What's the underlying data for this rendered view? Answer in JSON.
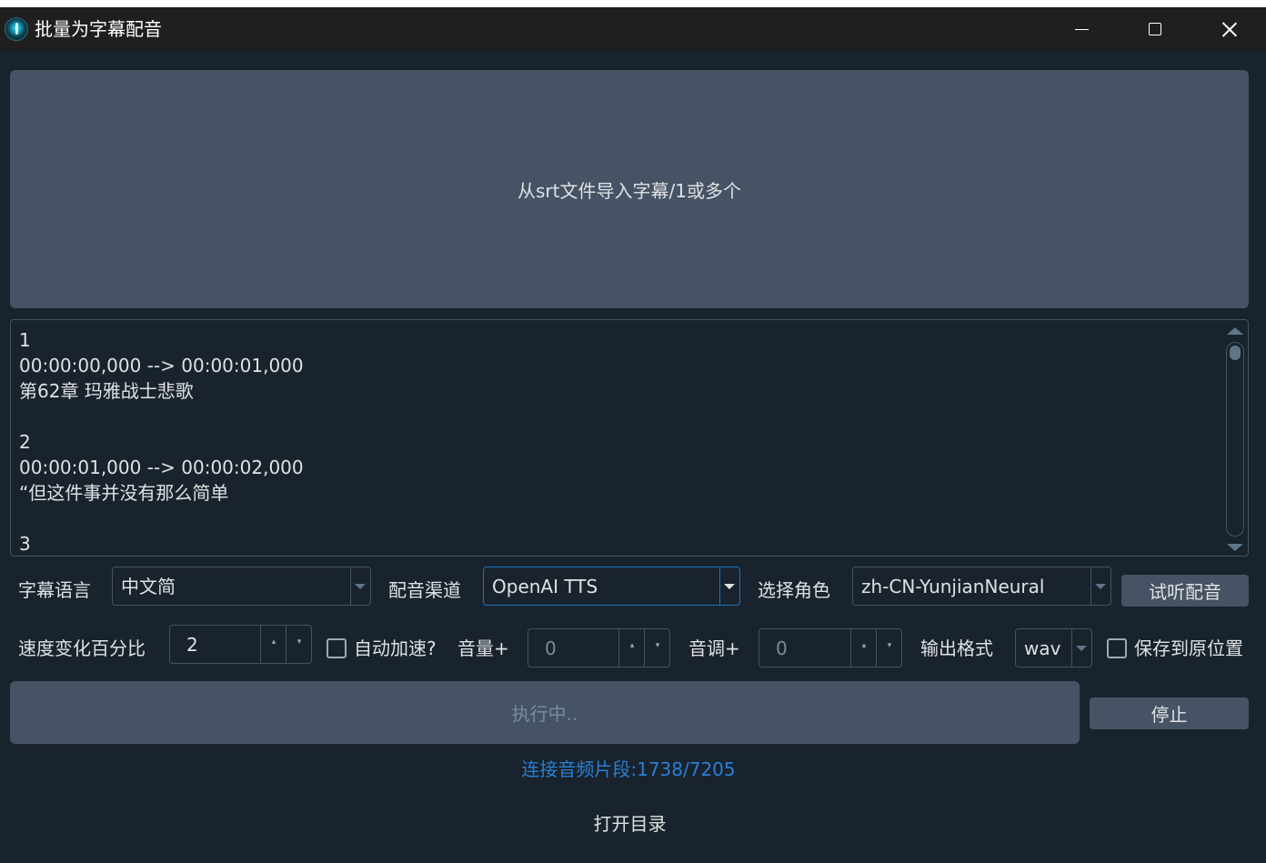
{
  "window": {
    "title": "批量为字幕配音"
  },
  "import_button_label": "从srt文件导入字幕/1或多个",
  "srt_content": {
    "lines": [
      "1",
      "00:00:00,000 --> 00:00:01,000",
      "第62章 玛雅战士悲歌",
      "",
      "2",
      "00:00:01,000 --> 00:00:02,000",
      "“但这件事并没有那么简单",
      "",
      "3"
    ]
  },
  "row1": {
    "subtitle_lang_label": "字幕语言",
    "subtitle_lang_value": "中文简",
    "tts_channel_label": "配音渠道",
    "tts_channel_value": "OpenAI TTS",
    "role_label": "选择角色",
    "role_value": "zh-CN-YunjianNeural",
    "preview_button": "试听配音"
  },
  "row2": {
    "speed_label": "速度变化百分比",
    "speed_value": "2",
    "auto_speed_label": "自动加速?",
    "auto_speed_checked": false,
    "volume_label": "音量+",
    "volume_value": "0",
    "pitch_label": "音调+",
    "pitch_value": "0",
    "format_label": "输出格式",
    "format_value": "wav",
    "save_original_label": "保存到原位置",
    "save_original_checked": false
  },
  "run": {
    "execute_label": "执行中..",
    "stop_label": "停止"
  },
  "status": {
    "text": "连接音频片段:1738/7205",
    "color": "#2a7fd4"
  },
  "open_dir_label": "打开目录",
  "colors": {
    "background": "#19232d",
    "button": "#455364",
    "accent_border": "#1a72bb"
  }
}
